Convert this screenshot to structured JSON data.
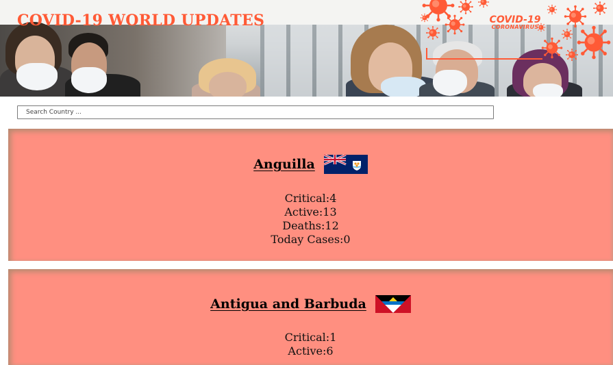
{
  "header": {
    "title": "COVID-19 WORLD UPDATES",
    "logo_line1": "COVID-19",
    "logo_line2": "CORONAVIRUS",
    "accent_color": "#ff5a36"
  },
  "search": {
    "placeholder": "Search Country ...",
    "value": ""
  },
  "countries": [
    {
      "name": "Anguilla",
      "flag_icon": "anguilla-flag-icon",
      "stats": [
        "Critical:4",
        "Active:13",
        "Deaths:12",
        "Today Cases:0"
      ]
    },
    {
      "name": "Antigua and Barbuda",
      "flag_icon": "antigua-barbuda-flag-icon",
      "stats": [
        "Critical:1",
        "Active:6"
      ]
    }
  ],
  "colors": {
    "card_background": "#ff8f80",
    "title_color": "#ff5a36"
  }
}
